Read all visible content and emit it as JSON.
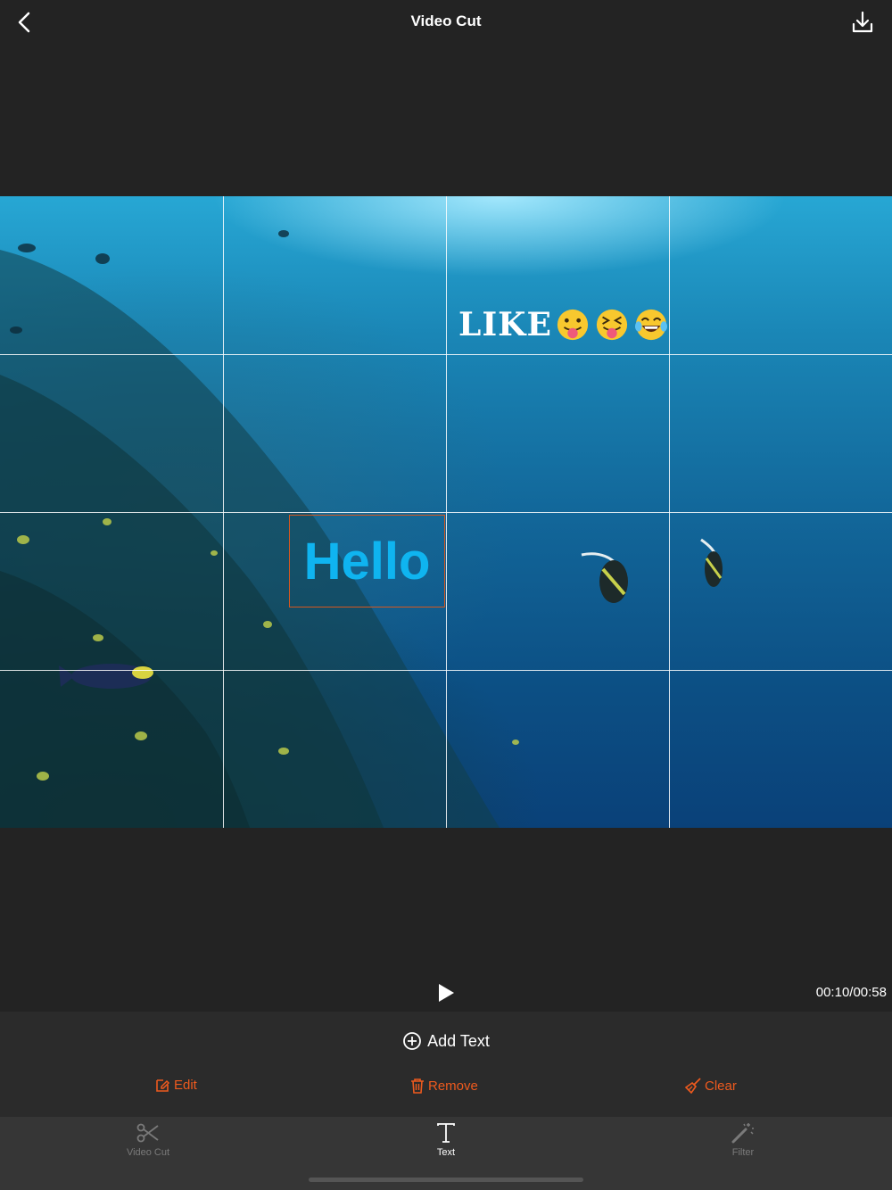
{
  "header": {
    "title": "Video Cut",
    "back_icon": "chevron-left-icon",
    "download_icon": "download-icon"
  },
  "video": {
    "grid": "3x4 rule-of-thirds overlay",
    "stickers": [
      {
        "text": "LIKE",
        "emojis": [
          "😛",
          "😝",
          "😂"
        ]
      }
    ],
    "text_overlays": [
      {
        "text": "Hello",
        "color": "#0fb4f0",
        "selected": true
      }
    ]
  },
  "playback": {
    "play_icon": "play-icon",
    "timecode": "00:10/00:58"
  },
  "text_panel": {
    "add_text_label": "Add Text",
    "actions": [
      {
        "label": "Edit",
        "icon": "edit-icon"
      },
      {
        "label": "Remove",
        "icon": "trash-icon"
      },
      {
        "label": "Clear",
        "icon": "broom-icon"
      }
    ],
    "accent_color": "#ee5a1e"
  },
  "tabs": [
    {
      "label": "Video Cut",
      "icon": "scissors-icon",
      "active": false
    },
    {
      "label": "Text",
      "icon": "text-icon",
      "active": true
    },
    {
      "label": "Filter",
      "icon": "magic-wand-icon",
      "active": false
    }
  ]
}
